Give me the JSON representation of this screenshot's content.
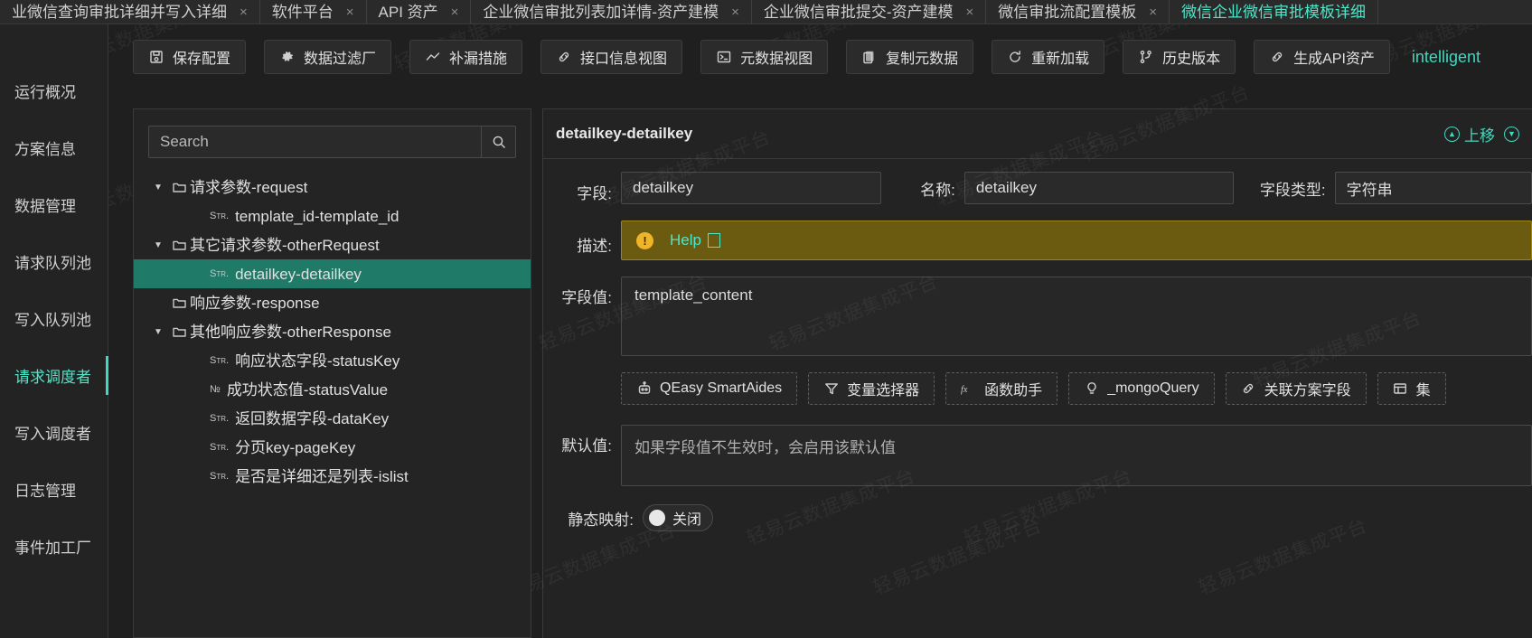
{
  "tabs": [
    {
      "label": "业微信查询审批详细并写入详细",
      "close": "×",
      "active": false
    },
    {
      "label": "软件平台",
      "close": "×",
      "active": false
    },
    {
      "label": "API 资产",
      "close": "×",
      "active": false
    },
    {
      "label": "企业微信审批列表加详情-资产建模",
      "close": "×",
      "active": false
    },
    {
      "label": "企业微信审批提交-资产建模",
      "close": "×",
      "active": false
    },
    {
      "label": "微信审批流配置模板",
      "close": "×",
      "active": false
    },
    {
      "label": "微信企业微信审批模板详细",
      "close": "×",
      "active": true
    }
  ],
  "sidebar": {
    "items": [
      {
        "label": "运行概况",
        "active": false
      },
      {
        "label": "方案信息",
        "active": false
      },
      {
        "label": "数据管理",
        "active": false
      },
      {
        "label": "请求队列池",
        "active": false
      },
      {
        "label": "写入队列池",
        "active": false
      },
      {
        "label": "请求调度者",
        "active": true
      },
      {
        "label": "写入调度者",
        "active": false
      },
      {
        "label": "日志管理",
        "active": false
      },
      {
        "label": "事件加工厂",
        "active": false
      }
    ]
  },
  "toolbar": {
    "buttons": [
      {
        "label": "保存配置",
        "icon": "save-icon"
      },
      {
        "label": "数据过滤厂",
        "icon": "gear-icon"
      },
      {
        "label": "补漏措施",
        "icon": "chart-icon"
      },
      {
        "label": "接口信息视图",
        "icon": "link-icon"
      },
      {
        "label": "元数据视图",
        "icon": "terminal-icon"
      },
      {
        "label": "复制元数据",
        "icon": "copy-icon"
      },
      {
        "label": "重新加载",
        "icon": "reload-icon"
      },
      {
        "label": "历史版本",
        "icon": "branch-icon"
      },
      {
        "label": "生成API资产",
        "icon": "link-icon"
      }
    ],
    "status_label": "intelligent"
  },
  "tree_panel": {
    "search": {
      "placeholder": "Search",
      "value": "",
      "icon": "search-icon"
    },
    "nodes": [
      {
        "label": "请求参数-request",
        "kind": "folder",
        "depth": 0,
        "expanded": true,
        "selected": false
      },
      {
        "label": "template_id-template_id",
        "kind": "leaf",
        "type_tag": "Str.",
        "depth": 1,
        "selected": false
      },
      {
        "label": "其它请求参数-otherRequest",
        "kind": "folder",
        "depth": 0,
        "expanded": true,
        "selected": false
      },
      {
        "label": "detailkey-detailkey",
        "kind": "leaf",
        "type_tag": "Str.",
        "depth": 1,
        "selected": true
      },
      {
        "label": "响应参数-response",
        "kind": "folder",
        "depth": 0,
        "expanded": false,
        "selected": false
      },
      {
        "label": "其他响应参数-otherResponse",
        "kind": "folder",
        "depth": 0,
        "expanded": true,
        "selected": false
      },
      {
        "label": "响应状态字段-statusKey",
        "kind": "leaf",
        "type_tag": "Str.",
        "depth": 1,
        "selected": false
      },
      {
        "label": "成功状态值-statusValue",
        "kind": "leaf",
        "type_tag": "№",
        "depth": 1,
        "selected": false
      },
      {
        "label": "返回数据字段-dataKey",
        "kind": "leaf",
        "type_tag": "Str.",
        "depth": 1,
        "selected": false
      },
      {
        "label": "分页key-pageKey",
        "kind": "leaf",
        "type_tag": "Str.",
        "depth": 1,
        "selected": false
      },
      {
        "label": "是否是详细还是列表-islist",
        "kind": "leaf",
        "type_tag": "Str.",
        "depth": 1,
        "selected": false
      }
    ]
  },
  "detail": {
    "title": "detailkey-detailkey",
    "move_up_label": "上移",
    "field_label": "字段:",
    "field_value": "detailkey",
    "name_label": "名称:",
    "name_value": "detailkey",
    "type_label": "字段类型:",
    "type_value": "字符串",
    "desc_label": "描述:",
    "desc_help": "Help",
    "value_label": "字段值:",
    "value_value": "template_content",
    "helpers": [
      {
        "label": "QEasy SmartAides",
        "icon": "robot-icon"
      },
      {
        "label": "变量选择器",
        "icon": "filter-icon"
      },
      {
        "label": "函数助手",
        "icon": "fx-icon"
      },
      {
        "label": "_mongoQuery",
        "icon": "bulb-icon"
      },
      {
        "label": "关联方案字段",
        "icon": "link-icon"
      },
      {
        "label": "集",
        "icon": "table-icon"
      }
    ],
    "default_label": "默认值:",
    "default_placeholder": "如果字段值不生效时，会启用该默认值",
    "static_label": "静态映射:",
    "static_state": "关闭"
  },
  "watermark_text": "轻易云数据集成平台",
  "colors": {
    "accent": "#3fd9bd",
    "selection": "#1f7a68",
    "warning_bg": "#6b5b10",
    "background": "#232323"
  }
}
